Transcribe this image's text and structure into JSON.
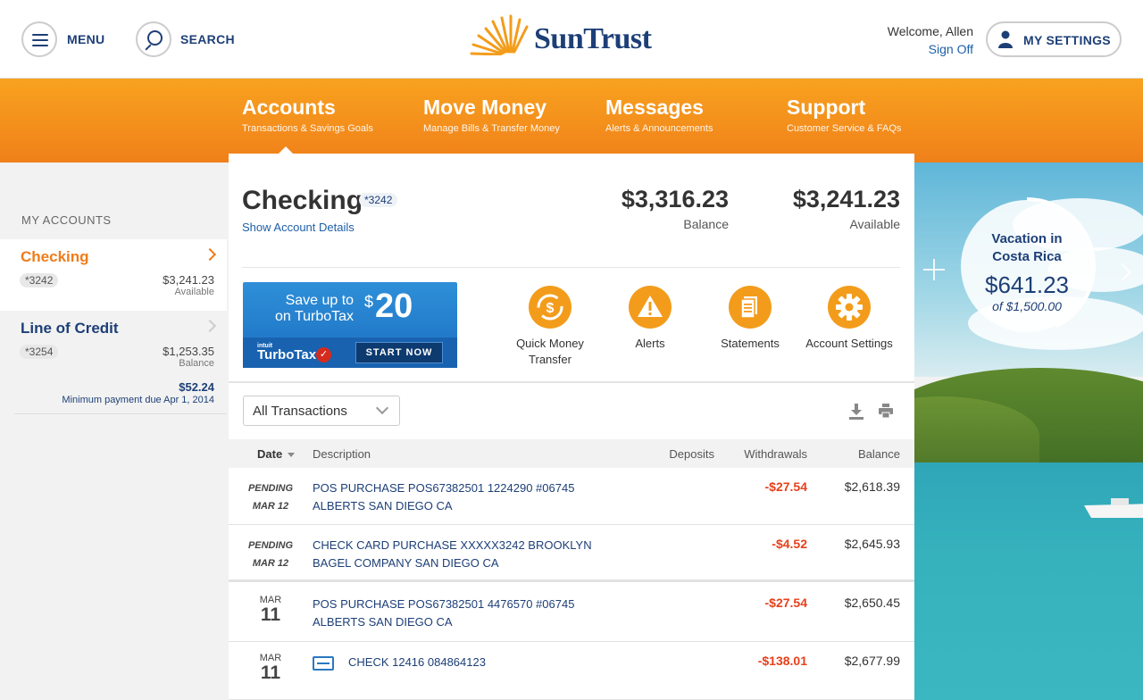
{
  "header": {
    "menu_label": "MENU",
    "search_label": "SEARCH",
    "logo_text": "SunTrust",
    "welcome": "Welcome, Allen",
    "sign_off": "Sign Off",
    "settings_label": "MY SETTINGS"
  },
  "nav": [
    {
      "title": "Accounts",
      "subtitle": "Transactions & Savings Goals"
    },
    {
      "title": "Move Money",
      "subtitle": "Manage Bills & Transfer Money"
    },
    {
      "title": "Messages",
      "subtitle": "Alerts & Announcements"
    },
    {
      "title": "Support",
      "subtitle": "Customer Service & FAQs"
    }
  ],
  "sidebar": {
    "heading": "MY ACCOUNTS",
    "accounts": [
      {
        "name": "Checking",
        "number": "*3242",
        "amount": "$3,241.23",
        "amount_label": "Available"
      },
      {
        "name": "Line of Credit",
        "number": "*3254",
        "amount": "$1,253.35",
        "amount_label": "Balance",
        "due_amount": "$52.24",
        "due_note": "Minimum payment due Apr 1, 2014"
      }
    ]
  },
  "account": {
    "title": "Checking",
    "number": "*3242",
    "details_link": "Show Account Details",
    "balance": "$3,316.23",
    "balance_label": "Balance",
    "available": "$3,241.23",
    "available_label": "Available"
  },
  "promo": {
    "line1": "Save up to",
    "line2": "on TurboTax",
    "currency": "$",
    "amount": "20",
    "brand_top": "intuit",
    "brand": "TurboTax",
    "cta": "START NOW"
  },
  "actions": [
    {
      "label": "Quick Money Transfer",
      "icon": "money-transfer-icon"
    },
    {
      "label": "Alerts",
      "icon": "alert-icon"
    },
    {
      "label": "Statements",
      "icon": "statements-icon"
    },
    {
      "label": "Account Settings",
      "icon": "gear-icon"
    }
  ],
  "filter": {
    "selected": "All Transactions"
  },
  "table": {
    "headers": {
      "date": "Date",
      "description": "Description",
      "deposits": "Deposits",
      "withdrawals": "Withdrawals",
      "balance": "Balance"
    },
    "rows": [
      {
        "status": "PENDING",
        "date": "MAR 12",
        "desc1": "POS PURCHASE POS67382501 1224290 #06745",
        "desc2": "ALBERTS SAN DIEGO CA",
        "withdrawal": "-$27.54",
        "balance": "$2,618.39"
      },
      {
        "status": "PENDING",
        "date": "MAR 12",
        "desc1": "CHECK CARD PURCHASE XXXXX3242 BROOKLYN",
        "desc2": "BAGEL COMPANY SAN DIEGO CA",
        "withdrawal": "-$4.52",
        "balance": "$2,645.93"
      },
      {
        "month": "MAR",
        "day": "11",
        "desc1": "POS PURCHASE POS67382501 4476570 #06745",
        "desc2": "ALBERTS SAN DIEGO CA",
        "withdrawal": "-$27.54",
        "balance": "$2,650.45"
      },
      {
        "month": "MAR",
        "day": "11",
        "desc1": "CHECK 12416 084864123",
        "withdrawal": "-$138.01",
        "balance": "$2,677.99"
      }
    ]
  },
  "goal": {
    "name_line1": "Vacation in",
    "name_line2": "Costa Rica",
    "amount": "$641.23",
    "target": "of $1,500.00",
    "progress_fraction": 0.4275
  },
  "colors": {
    "brand_blue": "#1d3f77",
    "brand_orange": "#f39c1b",
    "withdrawal_red": "#e8401c"
  }
}
